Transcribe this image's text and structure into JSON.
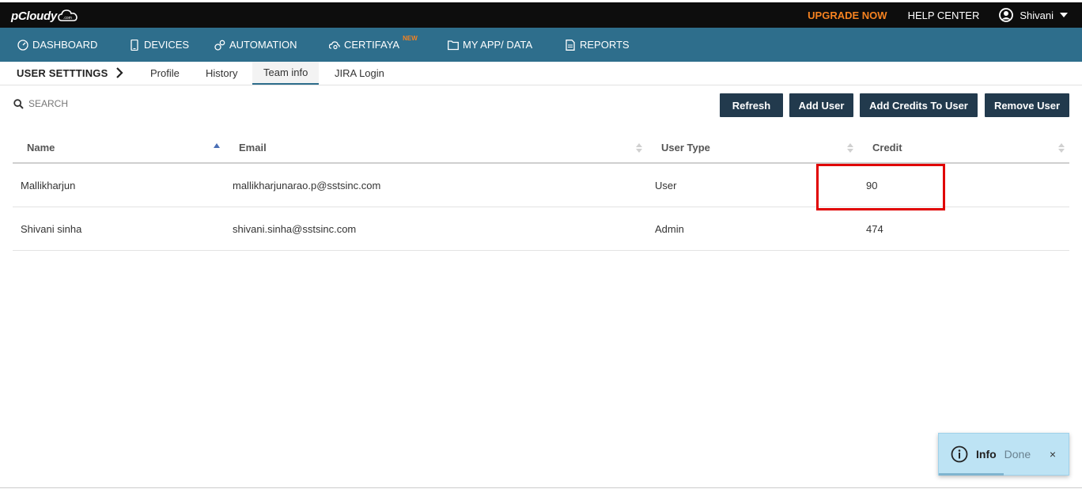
{
  "brand": {
    "logo_text": "pCloudy",
    "logo_sub": ".com"
  },
  "top": {
    "upgrade": "UPGRADE NOW",
    "help": "HELP CENTER",
    "user_name": "Shivani"
  },
  "nav": {
    "items": [
      {
        "label": "DASHBOARD",
        "icon": "gauge-icon"
      },
      {
        "label": "DEVICES",
        "icon": "mobile-icon"
      },
      {
        "label": "AUTOMATION",
        "icon": "gears-icon"
      },
      {
        "label": "CERTIFAYA",
        "icon": "cloud-search-icon",
        "badge": "NEW"
      },
      {
        "label": "MY APP/ DATA",
        "icon": "folder-icon"
      },
      {
        "label": "REPORTS",
        "icon": "document-icon"
      }
    ]
  },
  "settings": {
    "crumb": "USER SETTTINGS",
    "tabs": [
      {
        "label": "Profile"
      },
      {
        "label": "History"
      },
      {
        "label": "Team info",
        "active": true
      },
      {
        "label": "JIRA Login"
      }
    ]
  },
  "search": {
    "placeholder": "SEARCH"
  },
  "actions": {
    "refresh": "Refresh",
    "add_user": "Add User",
    "add_credits": "Add Credits To User",
    "remove_user": "Remove User"
  },
  "table": {
    "columns": [
      "Name",
      "Email",
      "User Type",
      "Credit"
    ],
    "rows": [
      {
        "name": "Mallikharjun",
        "email": "mallikharjunarao.p@sstsinc.com",
        "type": "User",
        "credit": "90"
      },
      {
        "name": "Shivani sinha",
        "email": "shivani.sinha@sstsinc.com",
        "type": "Admin",
        "credit": "474"
      }
    ]
  },
  "toast": {
    "title": "Info",
    "message": "Done",
    "close": "×"
  },
  "colors": {
    "topbar": "#0d0d0d",
    "navbar": "#2e6e8c",
    "button": "#223a4d",
    "accent": "#f58220",
    "highlight": "#e00000",
    "toast_bg": "#bde3f4"
  }
}
